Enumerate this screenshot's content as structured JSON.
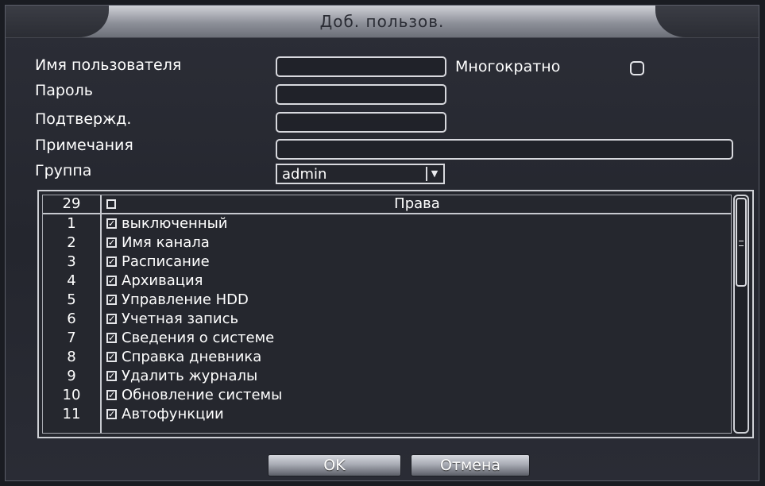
{
  "dialog": {
    "title": "Доб. пользов.",
    "username_label": "Имя пользователя",
    "username_value": "",
    "multi_label": "Многократно",
    "multi_checked": false,
    "password_label": "Пароль",
    "password_value": "",
    "confirm_label": "Подтвержд.",
    "confirm_value": "",
    "notes_label": "Примечания",
    "notes_value": "",
    "group_label": "Группа",
    "group_value": "admin",
    "rights": {
      "count": "29",
      "header": "Права",
      "items": [
        {
          "num": "1",
          "label": "выключенный",
          "checked": true
        },
        {
          "num": "2",
          "label": "Имя канала",
          "checked": true
        },
        {
          "num": "3",
          "label": "Расписание",
          "checked": true
        },
        {
          "num": "4",
          "label": "Архивация",
          "checked": true
        },
        {
          "num": "5",
          "label": "Управление HDD",
          "checked": true
        },
        {
          "num": "6",
          "label": "Учетная запись",
          "checked": true
        },
        {
          "num": "7",
          "label": "Сведения о системе",
          "checked": true
        },
        {
          "num": "8",
          "label": "Справка дневника",
          "checked": true
        },
        {
          "num": "9",
          "label": "Удалить журналы",
          "checked": true
        },
        {
          "num": "10",
          "label": "Обновление системы",
          "checked": true
        },
        {
          "num": "11",
          "label": "Автофункции",
          "checked": true
        }
      ]
    },
    "ok_label": "OK",
    "cancel_label": "Отмена"
  }
}
